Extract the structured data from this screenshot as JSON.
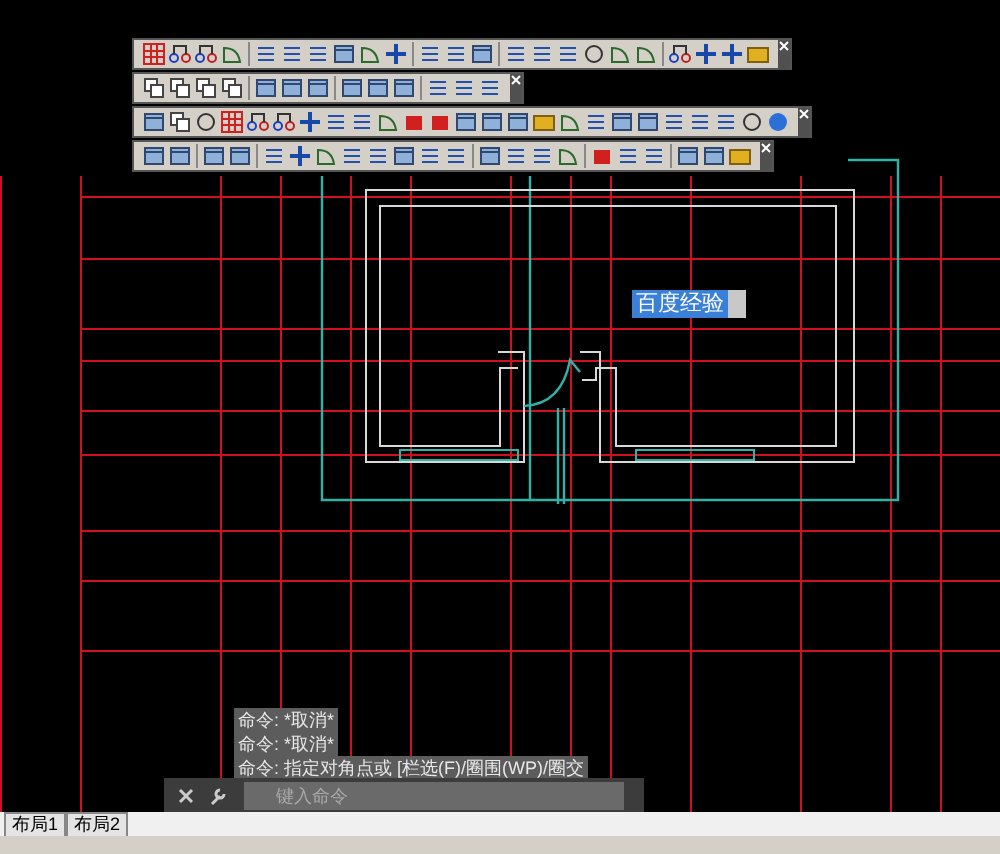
{
  "drawing": {
    "text_label": "百度经验"
  },
  "command_history": [
    "命令: *取消*",
    "命令: *取消*",
    "命令: 指定对角点或 [栏选(F)/圈围(WP)/圈交"
  ],
  "command_line": {
    "placeholder": "键入命令"
  },
  "layout_tabs": [
    {
      "label": "布局1",
      "selected": false
    },
    {
      "label": "布局2",
      "selected": false
    }
  ]
}
